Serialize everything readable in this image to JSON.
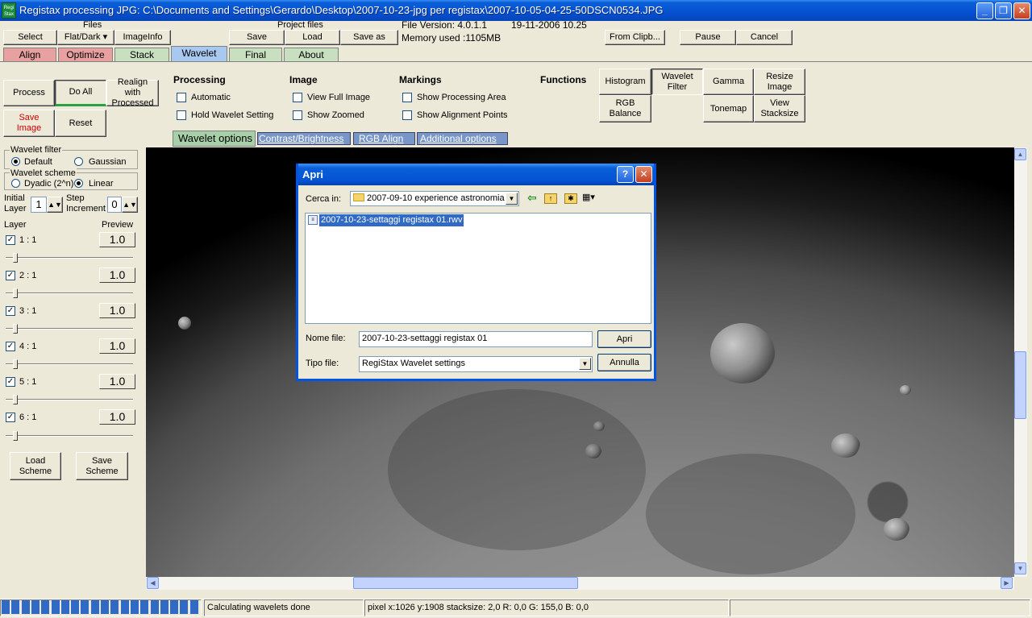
{
  "window": {
    "icon_text": "Regi Stax",
    "title": "Registax processing JPG: C:\\Documents and Settings\\Gerardo\\Desktop\\2007-10-23-jpg per registax\\2007-10-05-04-25-50DSCN0534.JPG",
    "minimize": "_",
    "maximize": "❐",
    "close": "✕"
  },
  "toolbar": {
    "files_label": "Files",
    "select": "Select",
    "flatdark": "Flat/Dark ▾",
    "imageinfo": "ImageInfo",
    "project_label": "Project files",
    "save": "Save",
    "load": "Load",
    "save_as": "Save as",
    "file_version": "File Version: 4.0.1.1",
    "date": "19-11-2006 10.25",
    "memory": "Memory used :1105MB",
    "from_clip": "From Clipb...",
    "pause": "Pause",
    "cancel": "Cancel"
  },
  "tabs": [
    "Align",
    "Optimize",
    "Stack",
    "Wavelet",
    "Final",
    "About"
  ],
  "actions": {
    "process": "Process",
    "do_all": "Do All",
    "realign": "Realign with Processed",
    "save_image": "Save Image",
    "reset": "Reset"
  },
  "processing": {
    "heading": "Processing",
    "automatic": "Automatic",
    "hold": "Hold Wavelet Setting"
  },
  "image": {
    "heading": "Image",
    "full": "View Full Image",
    "zoomed": "Show Zoomed"
  },
  "markings": {
    "heading": "Markings",
    "area": "Show Processing Area",
    "points": "Show Alignment Points"
  },
  "functions": {
    "heading": "Functions",
    "histogram": "Histogram",
    "wavelet_filter": "Wavelet Filter",
    "gamma": "Gamma",
    "resize": "Resize Image",
    "rgb_balance": "RGB Balance",
    "tonemap": "Tonemap",
    "stacksize": "View Stacksize"
  },
  "subtabs": [
    "Wavelet options",
    "Contrast/Brightness",
    "RGB Align",
    "Additional options"
  ],
  "wavelet": {
    "filter_label": "Wavelet filter",
    "default": "Default",
    "gaussian": "Gaussian",
    "scheme_label": "Wavelet scheme",
    "dyadic": "Dyadic (2^n)",
    "linear": "Linear",
    "initial_layer_label": "Initial Layer",
    "initial_layer_value": "1",
    "step_label": "Step Increment",
    "step_value": "0",
    "layer_col": "Layer",
    "preview_col": "Preview",
    "layers": [
      {
        "name": "1 : 1",
        "preview": "1.0"
      },
      {
        "name": "2 : 1",
        "preview": "1.0"
      },
      {
        "name": "3 : 1",
        "preview": "1.0"
      },
      {
        "name": "4 : 1",
        "preview": "1.0"
      },
      {
        "name": "5 : 1",
        "preview": "1.0"
      },
      {
        "name": "6 : 1",
        "preview": "1.0"
      }
    ],
    "load_scheme": "Load Scheme",
    "save_scheme": "Save Scheme"
  },
  "dialog": {
    "title": "Apri",
    "help": "?",
    "close": "✕",
    "lookin_label": "Cerca in:",
    "lookin_value": "2007-09-10 experience astronomia",
    "file_item": "2007-10-23-settaggi registax 01.rwv",
    "filename_label": "Nome file:",
    "filename_value": "2007-10-23-settaggi registax 01",
    "filetype_label": "Tipo file:",
    "filetype_value": "RegiStax Wavelet settings",
    "open": "Apri",
    "cancel": "Annulla"
  },
  "status": {
    "message": "Calculating wavelets done",
    "pixel": "pixel x:1026 y:1908 stacksize: 2,0 R: 0,0 G: 155,0 B: 0,0"
  },
  "colors": {
    "titlebar": "#0550d0",
    "tab_align": "#e8a0a0",
    "tab_stack": "#c8e0c0",
    "tab_wavelet": "#a8c8f0",
    "progress": "#316ac5"
  }
}
